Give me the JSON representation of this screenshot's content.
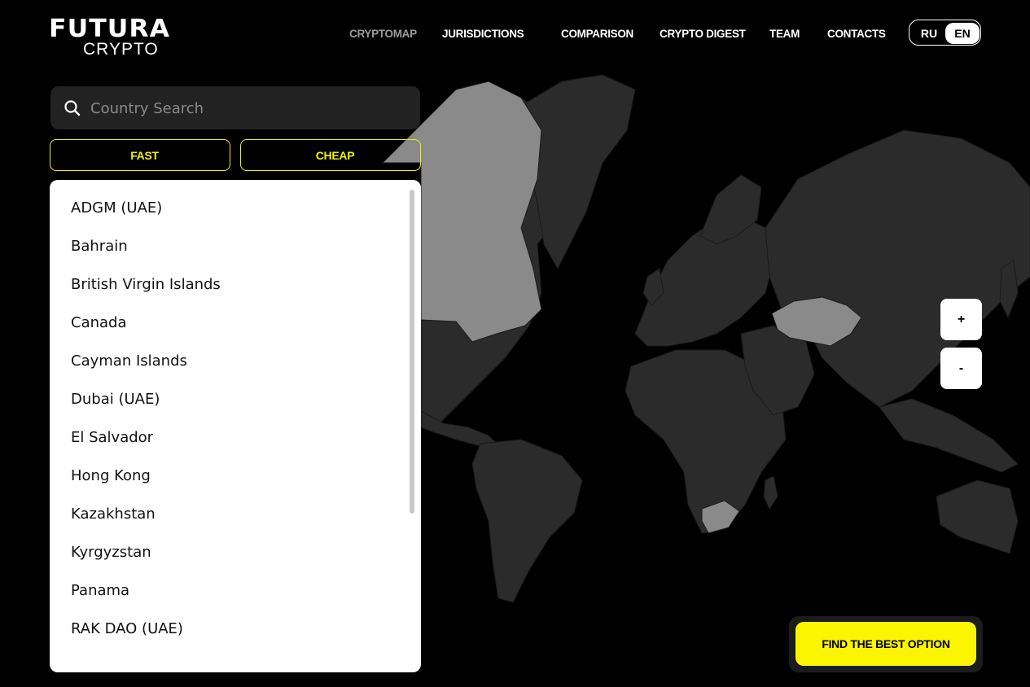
{
  "brand": {
    "logo_top": "FUTURA",
    "logo_bottom": "CRYPTO"
  },
  "nav": {
    "items": [
      {
        "label": "CRYPTOMAP",
        "active": true
      },
      {
        "label": "JURISDICTIONS"
      },
      {
        "label": "COMPARISON"
      },
      {
        "label": "CRYPTO DIGEST"
      },
      {
        "label": "TEAM"
      },
      {
        "label": "CONTACTS"
      }
    ]
  },
  "language": {
    "ru": "RU",
    "en": "EN",
    "selected": "EN"
  },
  "search": {
    "placeholder": "Country Search",
    "value": ""
  },
  "filters": {
    "fast": "FAST",
    "cheap": "CHEAP"
  },
  "countries": [
    "ADGM (UAE)",
    "Bahrain",
    "British Virgin Islands",
    "Canada",
    "Cayman Islands",
    "Dubai (UAE)",
    "El Salvador",
    "Hong Kong",
    "Kazakhstan",
    "Kyrgyzstan",
    "Panama",
    "RAK DAO (UAE)"
  ],
  "zoom": {
    "in": "+",
    "out": "-"
  },
  "cta": {
    "label": "FIND THE BEST OPTION"
  },
  "colors": {
    "accent": "#fbf500",
    "map_land": "#2b2b2b",
    "map_highlight": "#8a8a8a",
    "background": "#000000"
  }
}
